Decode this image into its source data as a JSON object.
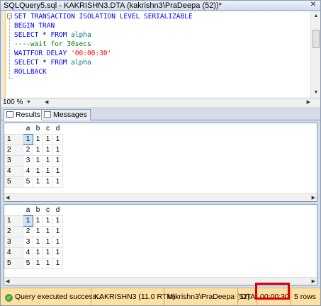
{
  "window": {
    "tab_title": "SQLQuery5.sql - KAKRISHN3.DTA (kakrishn3\\PraDeepa (52))*",
    "close_glyph": "✕"
  },
  "editor": {
    "lines": [
      [
        {
          "t": "SET TRANSACTION ISOLATION LEVEL SERIALIZABLE",
          "c": "kw"
        }
      ],
      [
        {
          "t": "BEGIN TRAN",
          "c": "kw"
        }
      ],
      [
        {
          "t": "SELECT ",
          "c": "kw"
        },
        {
          "t": "* ",
          "c": ""
        },
        {
          "t": "FROM ",
          "c": "kw"
        },
        {
          "t": "alpha",
          "c": "tbl"
        }
      ],
      [
        {
          "t": "----wait for 30secs",
          "c": "cmt"
        }
      ],
      [
        {
          "t": "WAITFOR DELAY ",
          "c": "kw"
        },
        {
          "t": "'00:00:30'",
          "c": "str"
        }
      ],
      [
        {
          "t": "SELECT ",
          "c": "kw"
        },
        {
          "t": "* ",
          "c": ""
        },
        {
          "t": "FROM ",
          "c": "kw"
        },
        {
          "t": "alpha",
          "c": "tbl"
        }
      ],
      [
        {
          "t": "ROLLBACK",
          "c": "kw"
        }
      ]
    ]
  },
  "zoom": {
    "value": "100 %"
  },
  "results_tabs": {
    "results_label": "Results",
    "messages_label": "Messages"
  },
  "grid1": {
    "columns": [
      "a",
      "b",
      "c",
      "d"
    ],
    "rows": [
      [
        "1",
        "1",
        "1",
        "1",
        "1"
      ],
      [
        "2",
        "2",
        "1",
        "1",
        "1"
      ],
      [
        "3",
        "3",
        "1",
        "1",
        "1"
      ],
      [
        "4",
        "4",
        "1",
        "1",
        "1"
      ],
      [
        "5",
        "5",
        "1",
        "1",
        "1"
      ]
    ]
  },
  "grid2": {
    "columns": [
      "a",
      "b",
      "c",
      "d"
    ],
    "rows": [
      [
        "1",
        "1",
        "1",
        "1",
        "1"
      ],
      [
        "2",
        "2",
        "1",
        "1",
        "1"
      ],
      [
        "3",
        "3",
        "1",
        "1",
        "1"
      ],
      [
        "4",
        "4",
        "1",
        "1",
        "1"
      ],
      [
        "5",
        "5",
        "1",
        "1",
        "1"
      ]
    ]
  },
  "status": {
    "message": "Query executed success...",
    "server": "KAKRISHN3 (11.0 RTM)",
    "user": "kakrishn3\\PraDeepa (52)",
    "database": "DTA",
    "elapsed": "00:00:30",
    "rows": "5 rows",
    "bar_color": "#ffe0a3",
    "highlight_color": "#e00000"
  }
}
